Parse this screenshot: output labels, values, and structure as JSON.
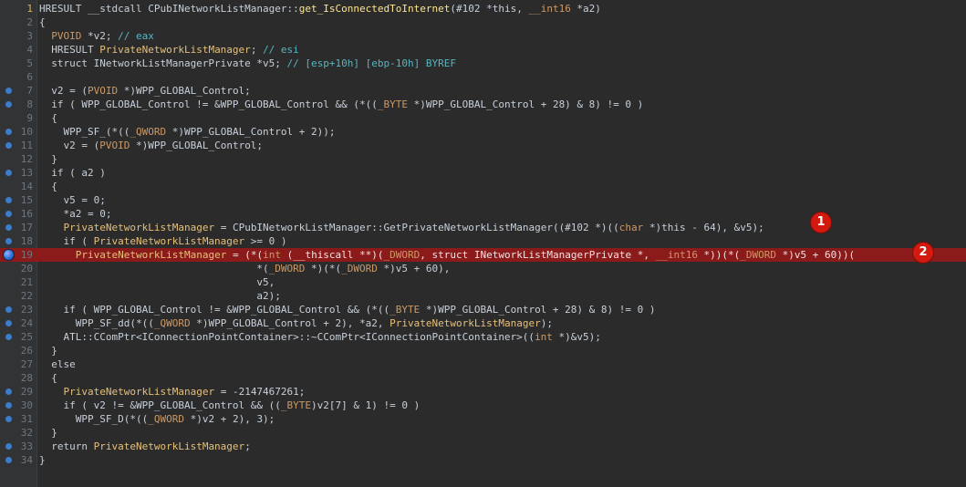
{
  "lines": [
    {
      "n": "1",
      "bp": false,
      "hl": false,
      "text": "HRESULT __stdcall CPubINetworkListManager::get_IsConnectedToInternet(#102 *this, __int16 *a2)"
    },
    {
      "n": "2",
      "bp": false,
      "hl": false,
      "text": "{"
    },
    {
      "n": "3",
      "bp": false,
      "hl": false,
      "text": "  PVOID *v2; // eax"
    },
    {
      "n": "4",
      "bp": false,
      "hl": false,
      "text": "  HRESULT PrivateNetworkListManager; // esi"
    },
    {
      "n": "5",
      "bp": false,
      "hl": false,
      "text": "  struct INetworkListManagerPrivate *v5; // [esp+10h] [ebp-10h] BYREF"
    },
    {
      "n": "6",
      "bp": false,
      "hl": false,
      "text": ""
    },
    {
      "n": "7",
      "bp": true,
      "hl": false,
      "text": "  v2 = (PVOID *)WPP_GLOBAL_Control;"
    },
    {
      "n": "8",
      "bp": true,
      "hl": false,
      "text": "  if ( WPP_GLOBAL_Control != &WPP_GLOBAL_Control && (*((_BYTE *)WPP_GLOBAL_Control + 28) & 8) != 0 )"
    },
    {
      "n": "9",
      "bp": false,
      "hl": false,
      "text": "  {"
    },
    {
      "n": "10",
      "bp": true,
      "hl": false,
      "text": "    WPP_SF_(*((_QWORD *)WPP_GLOBAL_Control + 2));"
    },
    {
      "n": "11",
      "bp": true,
      "hl": false,
      "text": "    v2 = (PVOID *)WPP_GLOBAL_Control;"
    },
    {
      "n": "12",
      "bp": false,
      "hl": false,
      "text": "  }"
    },
    {
      "n": "13",
      "bp": true,
      "hl": false,
      "text": "  if ( a2 )"
    },
    {
      "n": "14",
      "bp": false,
      "hl": false,
      "text": "  {"
    },
    {
      "n": "15",
      "bp": true,
      "hl": false,
      "text": "    v5 = 0;"
    },
    {
      "n": "16",
      "bp": true,
      "hl": false,
      "text": "    *a2 = 0;"
    },
    {
      "n": "17",
      "bp": true,
      "hl": false,
      "text": "    PrivateNetworkListManager = CPubINetworkListManager::GetPrivateNetworkListManager((#102 *)((char *)this - 64), &v5);"
    },
    {
      "n": "18",
      "bp": true,
      "hl": false,
      "text": "    if ( PrivateNetworkListManager >= 0 )"
    },
    {
      "n": "19",
      "bp": true,
      "hl": true,
      "active": true,
      "text": "      PrivateNetworkListManager = (*(int (__thiscall **)(_DWORD, struct INetworkListManagerPrivate *, __int16 *))(*(_DWORD *)v5 + 60))("
    },
    {
      "n": "20",
      "bp": false,
      "hl": false,
      "text": "                                    *(_DWORD *)(*(_DWORD *)v5 + 60),"
    },
    {
      "n": "21",
      "bp": false,
      "hl": false,
      "text": "                                    v5,"
    },
    {
      "n": "22",
      "bp": false,
      "hl": false,
      "text": "                                    a2);"
    },
    {
      "n": "23",
      "bp": true,
      "hl": false,
      "text": "    if ( WPP_GLOBAL_Control != &WPP_GLOBAL_Control && (*((_BYTE *)WPP_GLOBAL_Control + 28) & 8) != 0 )"
    },
    {
      "n": "24",
      "bp": true,
      "hl": false,
      "text": "      WPP_SF_dd(*((_QWORD *)WPP_GLOBAL_Control + 2), *a2, PrivateNetworkListManager);"
    },
    {
      "n": "25",
      "bp": true,
      "hl": false,
      "text": "    ATL::CComPtr<IConnectionPointContainer>::~CComPtr<IConnectionPointContainer>((int *)&v5);"
    },
    {
      "n": "26",
      "bp": false,
      "hl": false,
      "text": "  }"
    },
    {
      "n": "27",
      "bp": false,
      "hl": false,
      "text": "  else"
    },
    {
      "n": "28",
      "bp": false,
      "hl": false,
      "text": "  {"
    },
    {
      "n": "29",
      "bp": true,
      "hl": false,
      "text": "    PrivateNetworkListManager = -2147467261;"
    },
    {
      "n": "30",
      "bp": true,
      "hl": false,
      "text": "    if ( v2 != &WPP_GLOBAL_Control && ((_BYTE)v2[7] & 1) != 0 )"
    },
    {
      "n": "31",
      "bp": true,
      "hl": false,
      "text": "      WPP_SF_D(*((_QWORD *)v2 + 2), 3);"
    },
    {
      "n": "32",
      "bp": false,
      "hl": false,
      "text": "  }"
    },
    {
      "n": "33",
      "bp": true,
      "hl": false,
      "text": "  return PrivateNetworkListManager;"
    },
    {
      "n": "34",
      "bp": true,
      "hl": false,
      "text": "}"
    }
  ],
  "badges": [
    "1",
    "2"
  ],
  "colors": {
    "background": "#2b2b2b",
    "highlight": "#8b1a1a",
    "breakpoint": "#3d7cc9",
    "badge": "#d31a10"
  }
}
